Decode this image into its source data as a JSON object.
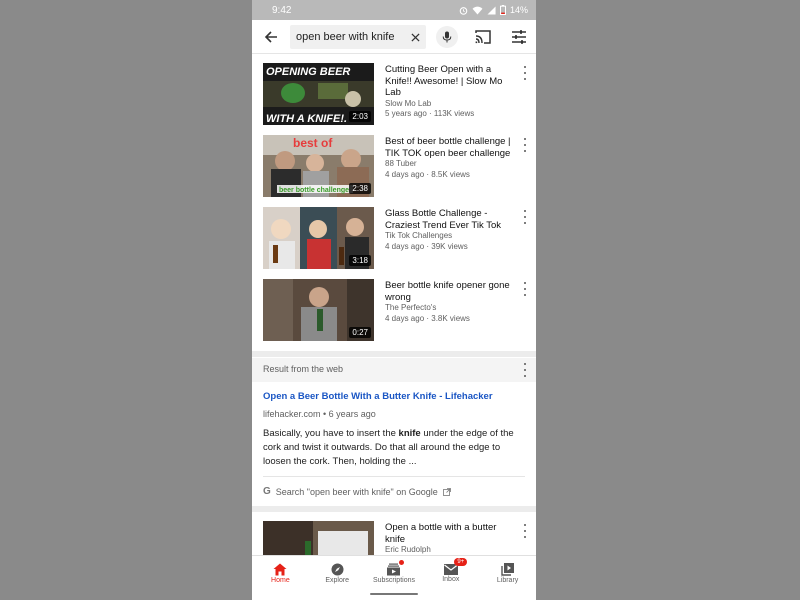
{
  "status_bar": {
    "time": "9:42",
    "battery": "14%"
  },
  "search": {
    "query": "open beer with knife"
  },
  "videos": [
    {
      "title": "Cutting Beer Open with a Knife!! Awesome! | Slow Mo Lab",
      "channel": "Slow Mo Lab",
      "meta": "5 years ago · 113K views",
      "duration": "2:03",
      "thumb_text_top": "OPENING BEER",
      "thumb_text_bottom": "WITH A KNIFE!."
    },
    {
      "title": "Best of beer bottle challenge | TIK TOK open beer challenge",
      "channel": "88 Tuber",
      "meta": "4 days ago · 8.5K views",
      "duration": "2:38",
      "thumb_text_top": "best of",
      "thumb_text_bottom": "beer bottle challenge"
    },
    {
      "title": "Glass Bottle Challenge - Craziest Trend Ever Tik Tok",
      "channel": "Tik Tok Challenges",
      "meta": "4 days ago · 39K views",
      "duration": "3:18"
    },
    {
      "title": "Beer bottle knife opener gone wrong",
      "channel": "The Perfecto's",
      "meta": "4 days ago · 3.8K views",
      "duration": "0:27"
    },
    {
      "title": "Open a bottle with a butter knife",
      "channel": "Eric Rudolph"
    }
  ],
  "web_result": {
    "header": "Result from the web",
    "link": "Open a Beer Bottle With a Butter Knife - Lifehacker",
    "source": "lifehacker.com • 6 years ago",
    "snippet_pre": "Basically, you have to insert the ",
    "snippet_bold": "knife",
    "snippet_post": " under the edge of the cork and twist it outwards. Do that all around the edge to loosen the cork. Then, holding the  ...",
    "google_search": "Search \"open beer with knife\" on Google"
  },
  "nav": [
    {
      "label": "Home",
      "icon": "home-icon"
    },
    {
      "label": "Explore",
      "icon": "compass-icon"
    },
    {
      "label": "Subscriptions",
      "icon": "subscriptions-icon"
    },
    {
      "label": "Inbox",
      "icon": "mail-icon",
      "badge": "9+"
    },
    {
      "label": "Library",
      "icon": "library-icon"
    }
  ],
  "colors": {
    "accent": "#e62117",
    "link": "#1a56c4"
  }
}
